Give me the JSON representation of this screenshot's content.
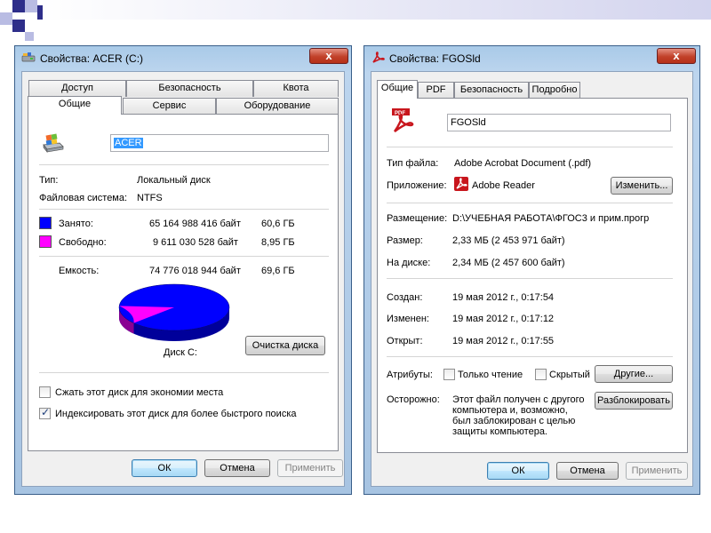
{
  "left_window": {
    "title": "Свойства: ACER (C:)",
    "close_symbol": "x",
    "tabs_top": [
      "Доступ",
      "Безопасность",
      "Квота"
    ],
    "tabs_bottom": [
      "Общие",
      "Сервис",
      "Оборудование"
    ],
    "active_tab": "Общие",
    "drive_label": "ACER",
    "type_label": "Тип:",
    "type_value": "Локальный диск",
    "fs_label": "Файловая система:",
    "fs_value": "NTFS",
    "used_label": "Занято:",
    "used_bytes": "65 164 988 416 байт",
    "used_size": "60,6 ГБ",
    "used_color": "#0000ff",
    "free_label": "Свободно:",
    "free_bytes": "9 611 030 528 байт",
    "free_size": "8,95 ГБ",
    "free_color": "#ff00ff",
    "capacity_label": "Емкость:",
    "capacity_bytes": "74 776 018 944 байт",
    "capacity_size": "69,6 ГБ",
    "used_fraction": 0.871,
    "disk_caption": "Диск C:",
    "cleanup_button": "Очистка диска",
    "compress_label": "Сжать этот диск для экономии места",
    "compress_checked": false,
    "index_label": "Индексировать этот диск для более быстрого поиска",
    "index_checked": true,
    "ok_button": "ОК",
    "cancel_button": "Отмена",
    "apply_button": "Применить"
  },
  "right_window": {
    "title": "Свойства: FGOSld",
    "close_symbol": "x",
    "tabs": [
      "Общие",
      "PDF",
      "Безопасность",
      "Подробно"
    ],
    "active_tab": "Общие",
    "file_name": "FGOSld",
    "filetype_label": "Тип файла:",
    "filetype_value": "Adobe Acrobat Document (.pdf)",
    "app_label": "Приложение:",
    "app_value": "Adobe Reader",
    "change_button": "Изменить...",
    "location_label": "Размещение:",
    "location_value": "D:\\УЧЕБНАЯ РАБОТА\\ФГОС3 и прим.прогр",
    "size_label": "Размер:",
    "size_value": "2,33 МБ (2 453 971 байт)",
    "disk_size_label": "На диске:",
    "disk_size_value": "2,34 МБ (2 457 600 байт)",
    "created_label": "Создан:",
    "created_value": "19 мая 2012 г., 0:17:54",
    "modified_label": "Изменен:",
    "modified_value": "19 мая 2012 г., 0:17:12",
    "opened_label": "Открыт:",
    "opened_value": "19 мая 2012 г., 0:17:55",
    "attributes_label": "Атрибуты:",
    "readonly_label": "Только чтение",
    "readonly_checked": false,
    "hidden_label": "Скрытый",
    "hidden_checked": false,
    "other_button": "Другие...",
    "caution_label": "Осторожно:",
    "caution_lines": [
      "Этот файл получен с другого",
      "компьютера и, возможно,",
      "был заблокирован с целью",
      "защиты компьютера."
    ],
    "unblock_button": "Разблокировать",
    "ok_button": "ОК",
    "cancel_button": "Отмена",
    "apply_button": "Применить"
  }
}
